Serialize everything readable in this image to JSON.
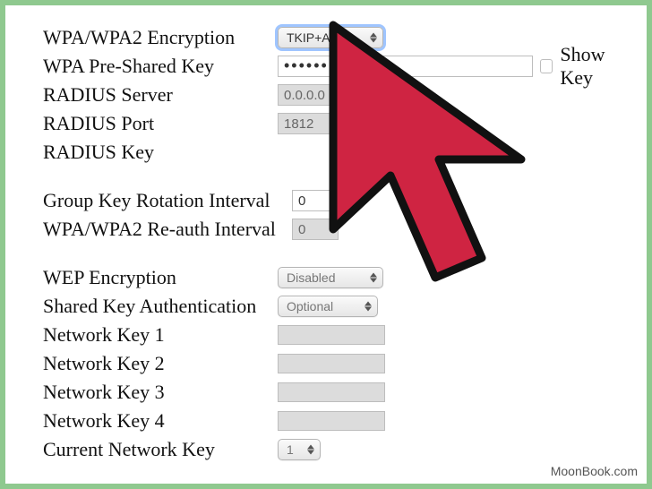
{
  "labels": {
    "wpa_encryption": "WPA/WPA2 Encryption",
    "wpa_preshared": "WPA Pre-Shared Key",
    "radius_server": "RADIUS Server",
    "radius_port": "RADIUS Port",
    "radius_key": "RADIUS Key",
    "group_key_interval": "Group Key Rotation Interval",
    "reauth_interval": "WPA/WPA2 Re-auth Interval",
    "wep_encryption": "WEP Encryption",
    "shared_key_auth": "Shared Key Authentication",
    "net_key_1": "Network Key 1",
    "net_key_2": "Network Key 2",
    "net_key_3": "Network Key 3",
    "net_key_4": "Network Key 4",
    "current_net_key": "Current Network Key",
    "show_key": "Show Key"
  },
  "values": {
    "wpa_encryption_selected": "TKIP+AES",
    "wpa_preshared_mask": "••••••",
    "radius_server": "0.0.0.0",
    "radius_port": "1812",
    "group_key_interval": "0",
    "reauth_interval": "0",
    "wep_encryption_selected": "Disabled",
    "shared_key_auth_selected": "Optional",
    "current_net_key_selected": "1"
  },
  "footer": {
    "watermark": "MoonBook.com"
  },
  "colors": {
    "border_green": "#8fc98f",
    "cursor_fill": "#cf2442",
    "cursor_stroke": "#111"
  }
}
